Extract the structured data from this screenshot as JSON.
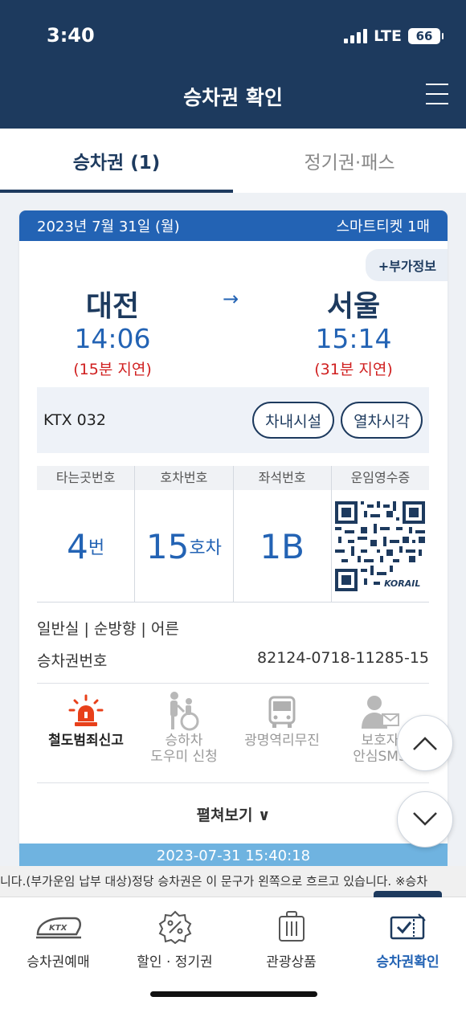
{
  "status": {
    "time": "3:40",
    "network": "LTE",
    "battery": "66"
  },
  "header": {
    "title": "승차권 확인"
  },
  "tabs": [
    {
      "label": "승차권 (1)"
    },
    {
      "label": "정기권·패스"
    }
  ],
  "ticket": {
    "date": "2023년 7월 31일 (월)",
    "ticket_type": "스마트티켓 1매",
    "extra_info_label": "+부가정보",
    "departure": {
      "station": "대전",
      "time": "14:06",
      "delay": "(15분 지연)"
    },
    "arrival": {
      "station": "서울",
      "time": "15:14",
      "delay": "(31분 지연)"
    },
    "train": "KTX 032",
    "facilities_label": "차내시설",
    "schedule_label": "열차시각",
    "seat_headers": [
      "타는곳번호",
      "호차번호",
      "좌석번호",
      "운임영수증"
    ],
    "platform": {
      "value": "4",
      "unit": "번"
    },
    "car": {
      "value": "15",
      "unit": "호차"
    },
    "seat": "1B",
    "qr_logo": "KORAIL",
    "class_info": "일반실 | 순방향 | 어른",
    "number_label": "승차권번호",
    "number_value": "82124-0718-11285-15",
    "services": [
      {
        "label": "철도범죄신고",
        "icon": "siren-icon"
      },
      {
        "label": "승하차\n도우미 신청",
        "icon": "wheelchair-icon"
      },
      {
        "label": "광명역리무진",
        "icon": "bus-icon"
      },
      {
        "label": "보호자\n안심SMS",
        "icon": "person-mail-icon"
      }
    ],
    "expand_label": "펼쳐보기 ∨",
    "timestamp": "2023-07-31 15:40:18"
  },
  "ticker_text": "니다.(부가운임 납부 대상)정당 승차권은 이 문구가 왼쪽으로 흐르고 있습니다. ※승차",
  "bottom_nav": [
    {
      "label": "승차권예매",
      "icon": "ktx-train-icon"
    },
    {
      "label": "할인 · 정기권",
      "icon": "discount-badge-icon"
    },
    {
      "label": "관광상품",
      "icon": "luggage-icon"
    },
    {
      "label": "승차권확인",
      "icon": "ticket-check-icon"
    }
  ],
  "colors": {
    "header_bg": "#1d3a5e",
    "accent": "#2363b4",
    "delay": "#d02020",
    "alert": "#e8401a"
  }
}
